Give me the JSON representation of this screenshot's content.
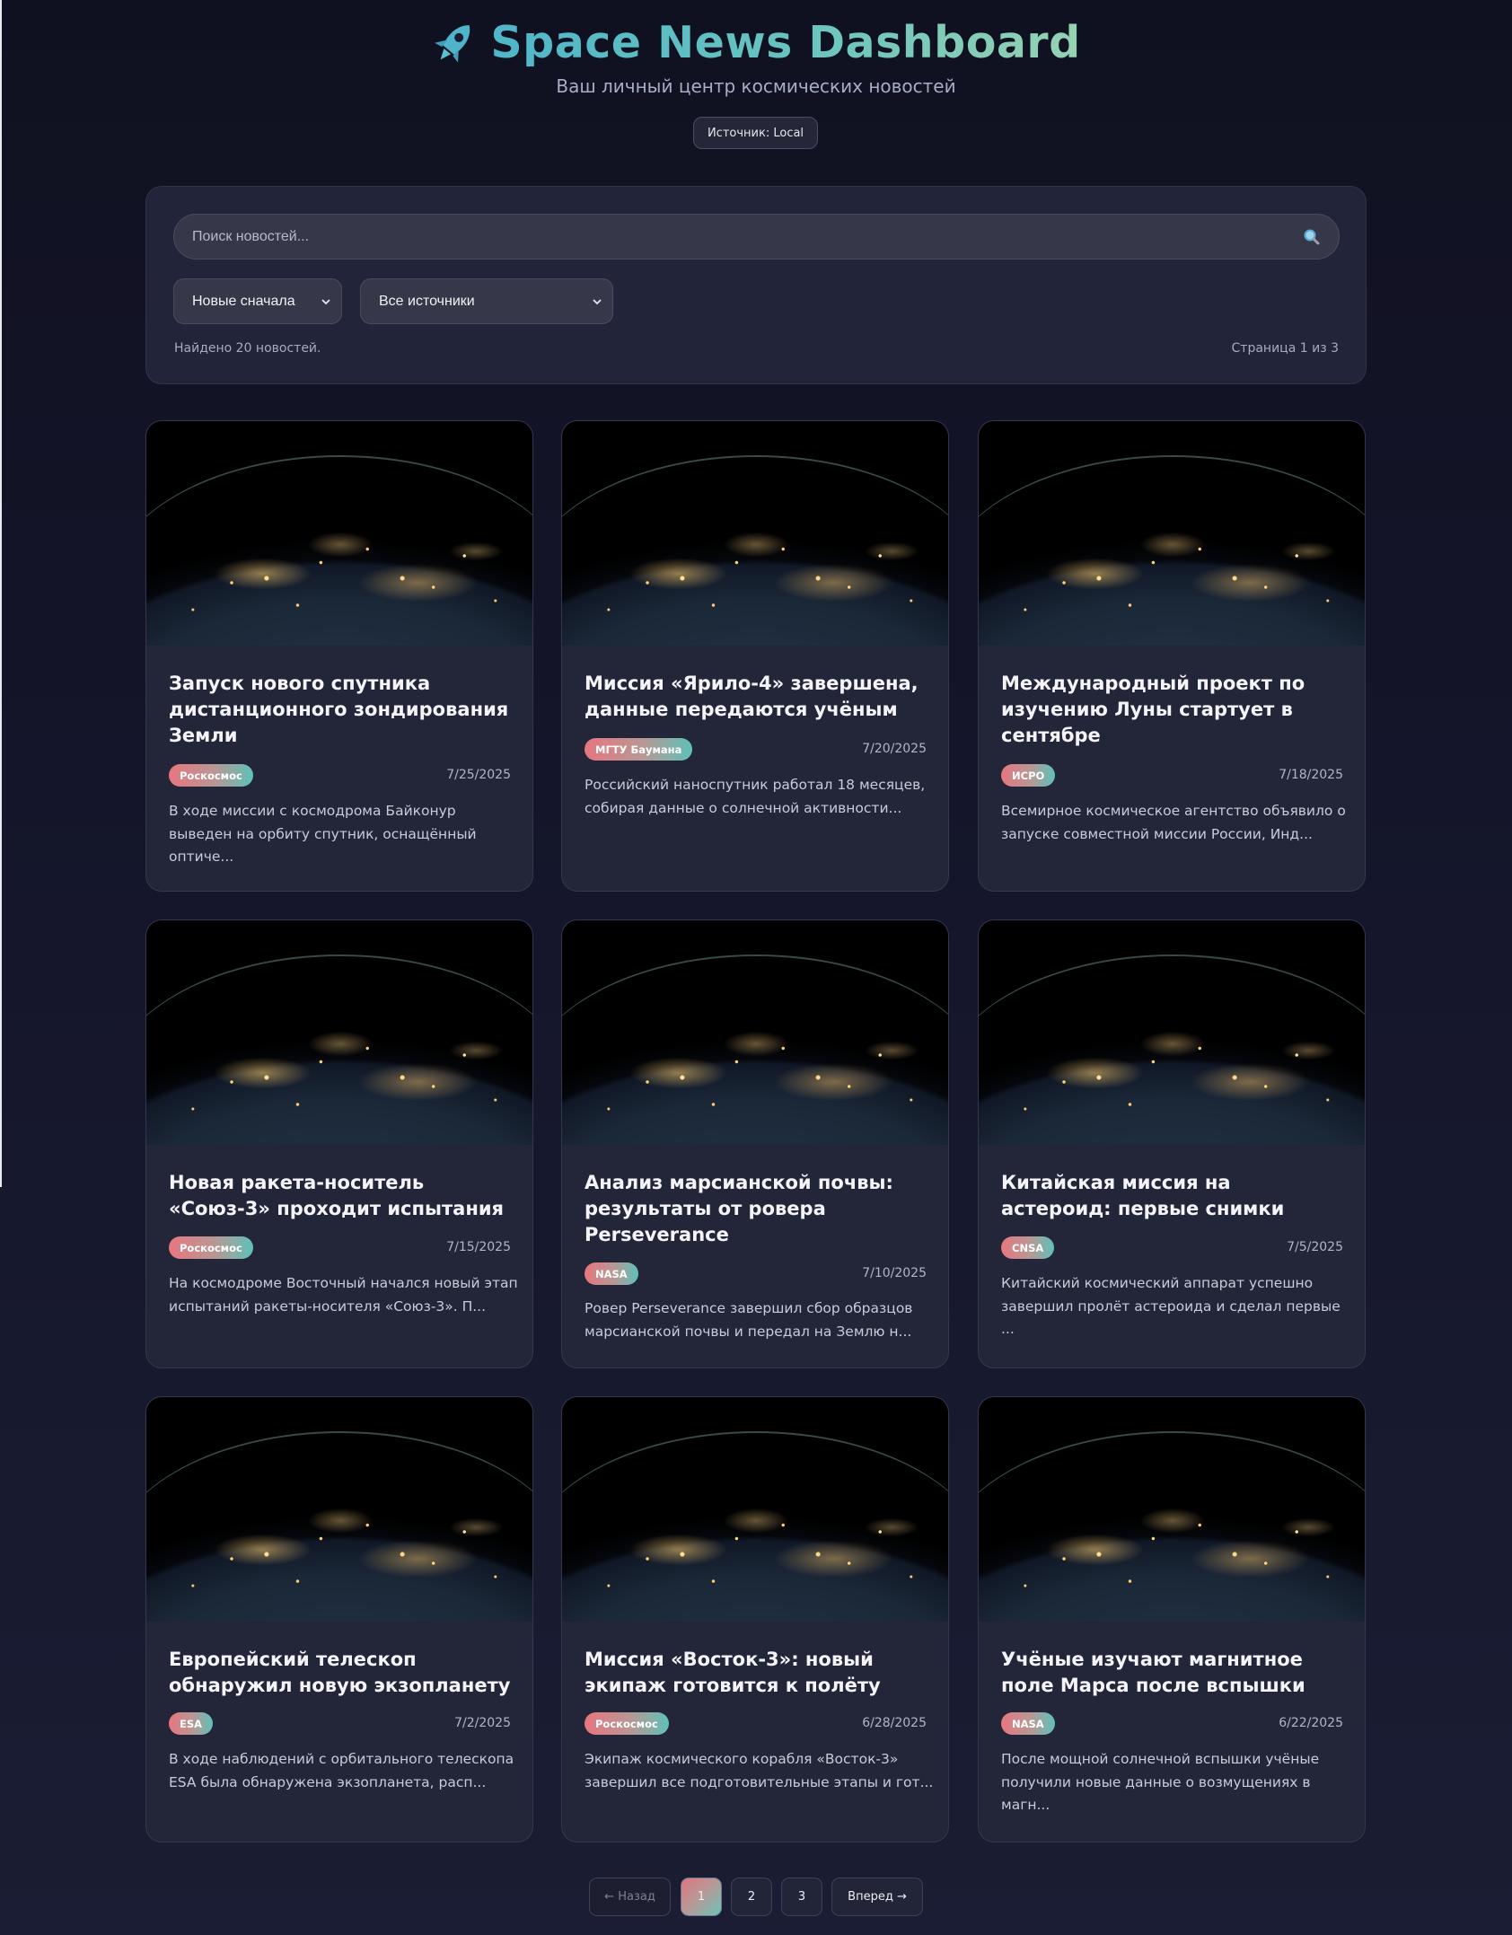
{
  "header": {
    "title": "Space News Dashboard",
    "subtitle": "Ваш личный центр космических новостей",
    "source_label": "Источник: Local",
    "icon": "rocket-icon"
  },
  "controls": {
    "search_placeholder": "Поиск новостей...",
    "sort_selected": "Новые сначала",
    "source_selected": "Все источники",
    "found_text": "Найдено 20 новостей.",
    "page_text": "Страница 1 из 3"
  },
  "cards": [
    {
      "title": "Запуск нового спутника дистанционного зондирования Земли",
      "source": "Роскосмос",
      "date": "7/25/2025",
      "excerpt": "В ходе миссии с космодрома Байконур выведен на орбиту спутник, оснащённый оптиче..."
    },
    {
      "title": "Миссия «Ярило-4» завершена, данные передаются учёным",
      "source": "МГТУ Баумана",
      "date": "7/20/2025",
      "excerpt": "Российский наноспутник работал 18 месяцев, собирая данные о солнечной активности..."
    },
    {
      "title": "Международный проект по изучению Луны стартует в сентябре",
      "source": "ИСРО",
      "date": "7/18/2025",
      "excerpt": "Всемирное космическое агентство объявило о запуске совместной миссии России, Инд..."
    },
    {
      "title": "Новая ракета-носитель «Союз-3» проходит испытания",
      "source": "Роскосмос",
      "date": "7/15/2025",
      "excerpt": "На космодроме Восточный начался новый этап испытаний ракеты-носителя «Союз-3». П..."
    },
    {
      "title": "Анализ марсианской почвы: результаты от ровера Perseverance",
      "source": "NASA",
      "date": "7/10/2025",
      "excerpt": "Ровер Perseverance завершил сбор образцов марсианской почвы и передал на Землю н..."
    },
    {
      "title": "Китайская миссия на астероид: первые снимки",
      "source": "CNSA",
      "date": "7/5/2025",
      "excerpt": "Китайский космический аппарат успешно завершил пролёт астероида и сделал первые ..."
    },
    {
      "title": "Европейский телескоп обнаружил новую экзопланету",
      "source": "ESA",
      "date": "7/2/2025",
      "excerpt": "В ходе наблюдений с орбитального телескопа ESA была обнаружена экзопланета, расп..."
    },
    {
      "title": "Миссия «Восток-3»: новый экипаж готовится к полёту",
      "source": "Роскосмос",
      "date": "6/28/2025",
      "excerpt": "Экипаж космического корабля «Восток-3» завершил все подготовительные этапы и гот..."
    },
    {
      "title": "Учёные изучают магнитное поле Марса после вспышки",
      "source": "NASA",
      "date": "6/22/2025",
      "excerpt": "После мощной солнечной вспышки учёные получили новые данные о возмущениях в магн..."
    }
  ],
  "pagination": {
    "prev": "← Назад",
    "pages": [
      "1",
      "2",
      "3"
    ],
    "current": "1",
    "next": "Вперед →"
  }
}
